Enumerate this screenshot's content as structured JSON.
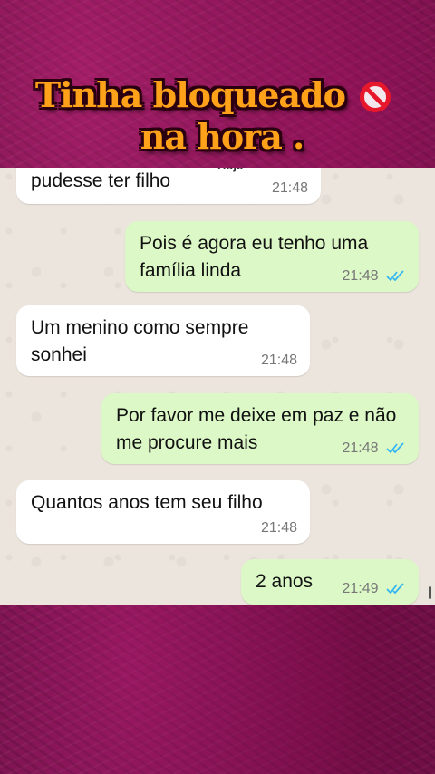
{
  "overlay": {
    "line1": "Tinha bloqueado",
    "line2": "na hora .",
    "emoji": "prohibited-icon"
  },
  "chat": {
    "date_label": "Hoje",
    "messages": [
      {
        "side": "in",
        "text": "pudesse ter filho",
        "time": "21:48"
      },
      {
        "side": "out",
        "text": "Pois é agora eu tenho uma família linda",
        "time": "21:48",
        "read": true
      },
      {
        "side": "in",
        "text": "Um menino como sempre sonhei",
        "time": "21:48"
      },
      {
        "side": "out",
        "text": "Por favor me deixe em paz e não me procure mais",
        "time": "21:48",
        "read": true
      },
      {
        "side": "in",
        "text": "Quantos anos tem seu filho",
        "time": "21:48"
      },
      {
        "side": "out",
        "text": "2 anos",
        "time": "21:49",
        "read": true
      }
    ]
  },
  "colors": {
    "background": "#6d1248",
    "headline": "#ffa21a",
    "incoming_bubble": "#ffffff",
    "outgoing_bubble": "#dcf8c6",
    "read_ticks": "#34b7f1"
  }
}
